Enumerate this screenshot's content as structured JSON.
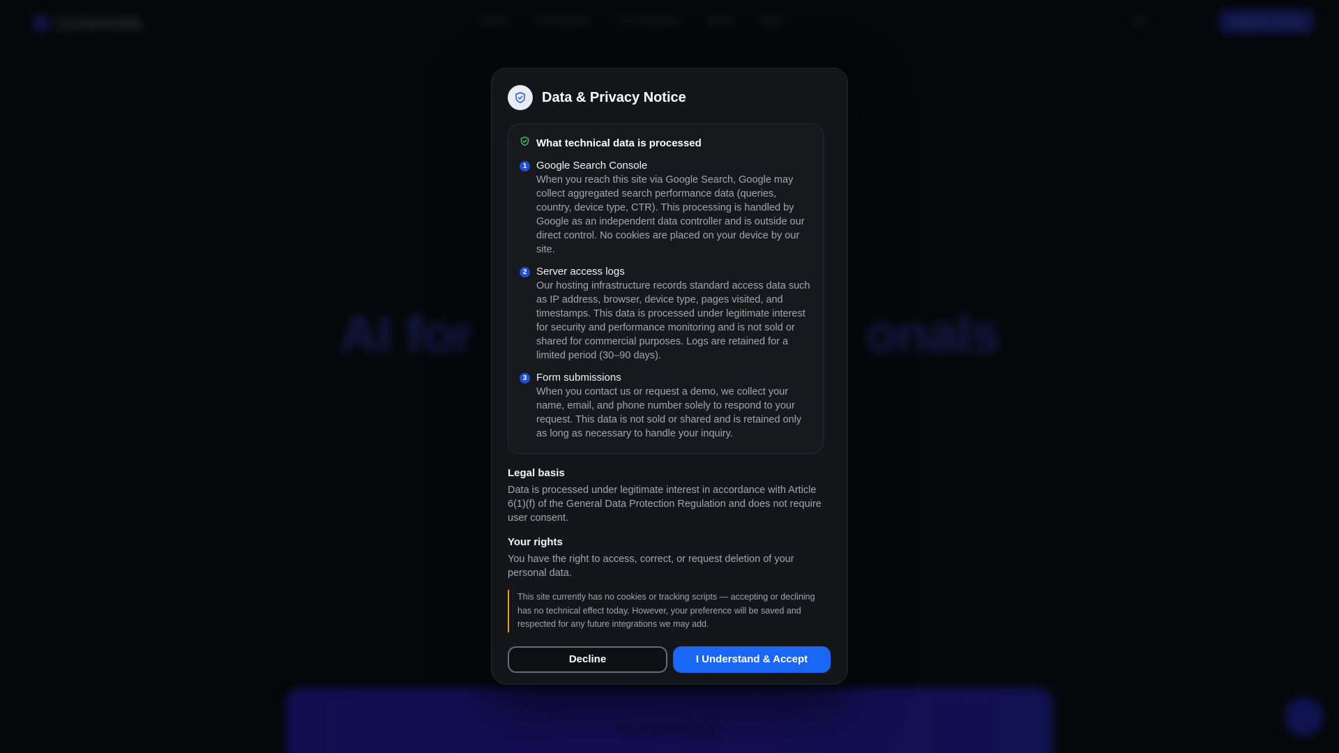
{
  "background": {
    "brand": "Cyclenceda",
    "nav_links": [
      "Home",
      "AI Solutions",
      "For Industries",
      "About",
      "Blog"
    ],
    "lang": "EN",
    "nav_cta": "Request a Demo",
    "hero_left": "AI for",
    "hero_right": "onals",
    "band_text": "Get started today"
  },
  "modal": {
    "title": "Data & Privacy Notice",
    "header_icon": "shield-check-icon",
    "card_title": "What technical data is processed",
    "card_icon": "shield-check-icon",
    "items": [
      {
        "number": "1",
        "title": "Google Search Console",
        "text": "When you reach this site via Google Search, Google may collect aggregated search performance data (queries, country, device type, CTR). This processing is handled by Google as an independent data controller and is outside our direct control. No cookies are placed on your device by our site."
      },
      {
        "number": "2",
        "title": "Server access logs",
        "text": "Our hosting infrastructure records standard access data such as IP address, browser, device type, pages visited, and timestamps. This data is processed under legitimate interest for security and performance monitoring and is not sold or shared for commercial purposes. Logs are retained for a limited period (30–90 days)."
      },
      {
        "number": "3",
        "title": "Form submissions",
        "text": "When you contact us or request a demo, we collect your name, email, and phone number solely to respond to your request. This data is not sold or shared and is retained only as long as necessary to handle your inquiry."
      }
    ],
    "legal_basis_title": "Legal basis",
    "legal_basis_text": "Data is processed under legitimate interest in accordance with Article 6(1)(f) of the General Data Protection Regulation and does not require user consent.",
    "rights_title": "Your rights",
    "rights_text": "You have the right to access, correct, or request deletion of your personal data.",
    "note": "This site currently has no cookies or tracking scripts — accepting or declining has no technical effect today. However, your preference will be saved and respected for any future integrations we may add.",
    "decline_label": "Decline",
    "accept_label": "I Understand & Accept"
  },
  "colors": {
    "accent": "#1a66f5",
    "number_badge": "#1f4ed8",
    "note_border": "#e3a31b",
    "shield_green": "#3fbf5f"
  }
}
